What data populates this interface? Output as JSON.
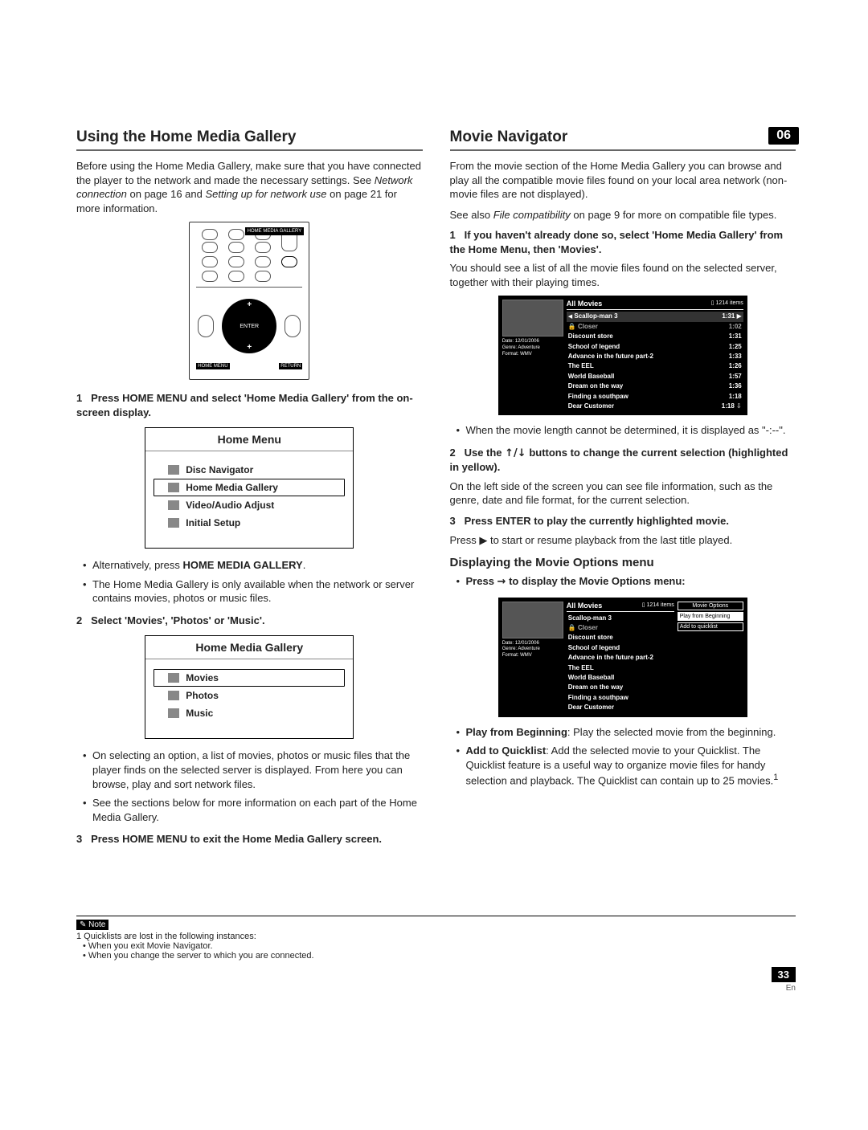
{
  "section_badge": "06",
  "left": {
    "heading": "Using the Home Media Gallery",
    "intro_a": "Before using the Home Media Gallery, make sure that you have connected the player to the network and made the necessary settings. See ",
    "intro_i1": "Network connection",
    "intro_b": " on page 16 and ",
    "intro_i2": "Setting up for network use",
    "intro_c": " on page 21 for more information.",
    "remote": {
      "label": "HOME MEDIA GALLERY",
      "enter": "ENTER",
      "tag_left": "HOME MENU",
      "tag_right": "RETURN"
    },
    "step1_num": "1",
    "step1_lead": "Press HOME MENU and select 'Home Media Gallery' from the on-screen display.",
    "home_menu": {
      "title": "Home Menu",
      "items": [
        "Disc Navigator",
        "Home Media Gallery",
        "Video/Audio Adjust",
        "Initial Setup"
      ],
      "selected_index": 1
    },
    "bullets1": [
      {
        "pre": "Alternatively, press ",
        "bold": "HOME MEDIA GALLERY",
        "post": "."
      },
      {
        "text": "The Home Media Gallery is only available when the network or server contains movies, photos or music files."
      }
    ],
    "step2_num": "2",
    "step2_lead": "Select 'Movies', 'Photos' or 'Music'.",
    "hmg_menu": {
      "title": "Home Media Gallery",
      "items": [
        "Movies",
        "Photos",
        "Music"
      ],
      "selected_index": 0
    },
    "bullets2": [
      "On selecting an option, a list of movies, photos or music files that the player finds on the selected server is displayed. From here you can browse, play and sort network files.",
      "See the sections below for more information on each part of the Home Media Gallery."
    ],
    "step3_num": "3",
    "step3_lead": "Press HOME MENU to exit the Home Media Gallery screen."
  },
  "right": {
    "heading": "Movie Navigator",
    "para1": "From the movie section of the Home Media Gallery you can browse and play all the compatible movie files found on your local area network (non-movie files are not displayed).",
    "para2_a": "See also ",
    "para2_i": "File compatibility",
    "para2_b": " on page 9 for more on compatible file types.",
    "step1_num": "1",
    "step1_lead": "If you haven't already done so, select 'Home Media Gallery' from the Home Menu, then 'Movies'.",
    "step1_body": "You should see a list of all the movie files found on the selected server, together with their playing times.",
    "nav_shot1": {
      "title": "All Movies",
      "items_count": "1214 items",
      "info_lines": [
        "Date: 12/01/2006",
        "Genre: Adventure",
        "Format: WMV"
      ],
      "rows": [
        {
          "t": "Scallop-man 3",
          "d": "1:31",
          "sel": true,
          "ind": "◀",
          "tail": "▶"
        },
        {
          "t": "Closer",
          "d": "1:02",
          "dim": true,
          "lock": true
        },
        {
          "t": "Discount store",
          "d": "1:31"
        },
        {
          "t": "School of legend",
          "d": "1:25"
        },
        {
          "t": "Advance in the future part-2",
          "d": "1:33"
        },
        {
          "t": "The EEL",
          "d": "1:26"
        },
        {
          "t": "World Baseball",
          "d": "1:57"
        },
        {
          "t": "Dream on the way",
          "d": "1:36"
        },
        {
          "t": "Finding a southpaw",
          "d": "1:18"
        },
        {
          "t": "Dear Customer",
          "d": "1:18",
          "tail": "⇩"
        }
      ]
    },
    "bullet_after1": "When the movie length cannot be determined, it is displayed as \"-:--\".",
    "step2_num": "2",
    "step2_lead_a": "Use the ",
    "step2_lead_glyph": "↑/↓",
    "step2_lead_b": " buttons to change the current selection (highlighted in yellow).",
    "step2_body": "On the left side of the screen you can see file information, such as the genre, date and file format, for the current selection.",
    "step3_num": "3",
    "step3_lead": "Press ENTER to play the currently highlighted movie.",
    "step3_body_a": "Press ",
    "step3_body_glyph": "▶",
    "step3_body_b": " to start or resume playback from the last title played.",
    "sub_heading": "Displaying the Movie Options menu",
    "opt_bullet_a": "Press ",
    "opt_bullet_glyph": "→",
    "opt_bullet_b": " to display the Movie Options menu:",
    "nav_shot2": {
      "title": "All Movies",
      "items_count": "1214 items",
      "info_lines": [
        "Date: 12/01/2006",
        "Genre: Adventure",
        "Format: WMV"
      ],
      "rows": [
        {
          "t": "Scallop-man 3"
        },
        {
          "t": "Closer",
          "dim": true,
          "lock": true
        },
        {
          "t": "Discount store"
        },
        {
          "t": "School of legend"
        },
        {
          "t": "Advance in the future part-2"
        },
        {
          "t": "The EEL"
        },
        {
          "t": "World Baseball"
        },
        {
          "t": "Dream on the way"
        },
        {
          "t": "Finding a southpaw"
        },
        {
          "t": "Dear Customer"
        }
      ],
      "options_title": "Movie  Options",
      "options": [
        "Play from Beginning",
        "Add to quicklist"
      ],
      "options_sel": 0
    },
    "opt_list": [
      {
        "bold": "Play from Beginning",
        "rest": ": Play the selected movie from the beginning."
      },
      {
        "bold": "Add to Quicklist",
        "rest": ": Add the selected movie to your Quicklist. The Quicklist feature is a useful way to organize movie files for handy selection and playback. The Quicklist can contain up to 25 movies.",
        "sup": "1"
      }
    ]
  },
  "footnote": {
    "label": "Note",
    "line1": "1 Quicklists are lost in the following instances:",
    "subs": [
      "When you exit Movie Navigator.",
      "When you change the server to which you are connected."
    ]
  },
  "page_number": "33",
  "page_lang": "En"
}
